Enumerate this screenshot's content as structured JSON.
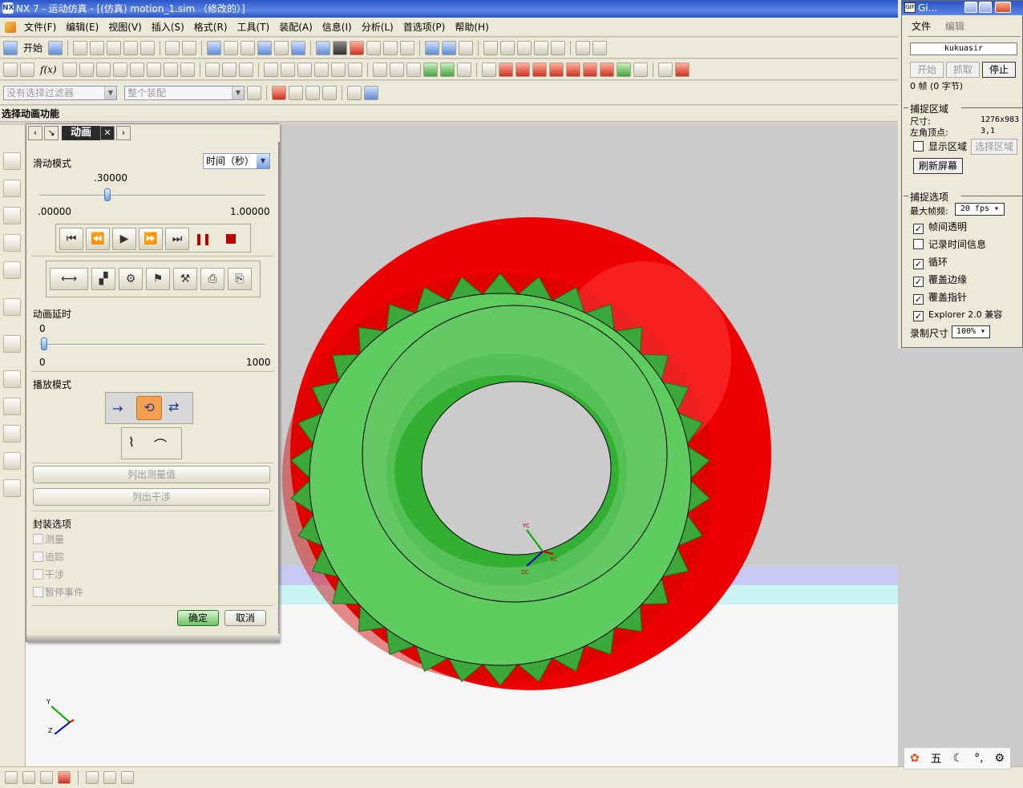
{
  "window": {
    "title": "NX 7 - 运动仿真 - [(仿真) motion_1.sim （修改的）]",
    "logo": "NX"
  },
  "menu": [
    {
      "label": "文件(F)"
    },
    {
      "label": "编辑(E)"
    },
    {
      "label": "视图(V)"
    },
    {
      "label": "插入(S)"
    },
    {
      "label": "格式(R)"
    },
    {
      "label": "工具(T)"
    },
    {
      "label": "装配(A)"
    },
    {
      "label": "信息(I)"
    },
    {
      "label": "分析(L)"
    },
    {
      "label": "首选项(P)"
    },
    {
      "label": "帮助(H)"
    }
  ],
  "toolbar": {
    "start_label": "开始",
    "fx_label": "f(x)"
  },
  "selection_bar": {
    "filter_placeholder": "没有选择过滤器",
    "scope_value": "整个装配"
  },
  "cue_line": "选择动画功能",
  "dialog": {
    "title": "动画",
    "slide_mode_label": "滑动模式",
    "slide_mode_value": "时间（秒）",
    "time_value": ".30000",
    "time_min": ".00000",
    "time_max": "1.00000",
    "time_fraction": 0.3,
    "delay_label": "动画延时",
    "delay_value": "0",
    "delay_min": "0",
    "delay_max": "1000",
    "play_mode_label": "播放模式",
    "list_measure_button": "列出测量值",
    "list_interference_button": "列出干涉",
    "package_options_label": "封装选项",
    "options": [
      {
        "label": "测量",
        "checked": false
      },
      {
        "label": "追踪",
        "checked": false
      },
      {
        "label": "干涉",
        "checked": false
      },
      {
        "label": "暂停事件",
        "checked": false
      }
    ],
    "ok_button": "确定",
    "cancel_button": "取消"
  },
  "gif_tool": {
    "title": "Gi...",
    "icon_text": "GIF",
    "menu": [
      "文件",
      "编辑"
    ],
    "author": "kukuasir",
    "buttons": {
      "start": "开始",
      "capture": "抓取",
      "stop": "停止"
    },
    "frames": "0 帧 (0 字节)",
    "capture_area_label": "捕捉区域",
    "size_label": "尺寸:",
    "size_value": "1276x983",
    "corner_label": "左角顶点:",
    "corner_value": "3,1",
    "show_area_label": "显示区域",
    "select_area_button": "选择区域",
    "refresh_button": "刷新屏幕",
    "capture_options_label": "捕捉选项",
    "max_fps_label": "最大帧频:",
    "max_fps_value": "20 fps",
    "checkboxes": [
      {
        "label": "帧间透明",
        "checked": true
      },
      {
        "label": "记录时间信息",
        "checked": false
      },
      {
        "label": "循环",
        "checked": true
      },
      {
        "label": "覆盖边缘",
        "checked": true
      },
      {
        "label": "覆盖指针",
        "checked": true
      },
      {
        "label": "Explorer 2.0 兼容",
        "checked": true
      }
    ],
    "record_size_label": "录制尺寸",
    "record_size_value": "100%"
  },
  "triad": {
    "x": "X",
    "y": "Y",
    "z": "Z",
    "xc": "XC",
    "yc": "YC",
    "zc": "ZC"
  },
  "ime": {
    "glyph": "五"
  },
  "colors": {
    "gear_red": "#ee0000",
    "gear_green": "#5fcc5f",
    "titlebar": "#2a56c8"
  }
}
